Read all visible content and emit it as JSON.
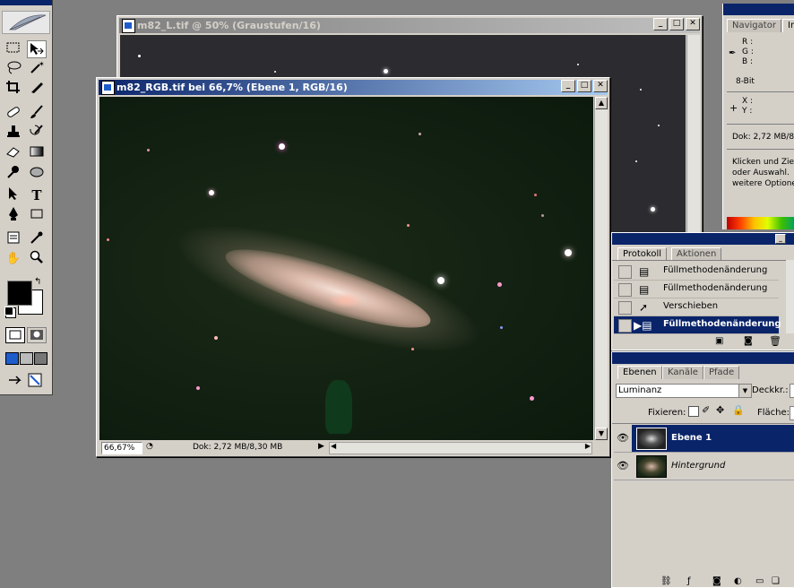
{
  "window_back": {
    "title": "m82_L.tif @ 50% (Graustufen/16)"
  },
  "window_front": {
    "title": "m82_RGB.tif bei 66,7% (Ebene 1, RGB/16)",
    "zoom": "66,67%",
    "doc_info": "Dok: 2,72 MB/8,30 MB"
  },
  "navigator": {
    "tab_navigator": "Navigator",
    "tab_info": "In",
    "r": "R :",
    "g": "G :",
    "b": "B :",
    "bit": "8-Bit",
    "x": "X :",
    "y": "Y :",
    "dok": "Dok: 2,72 MB/8",
    "hint": [
      "Klicken und Zie",
      "oder Auswahl.",
      "weitere Optione"
    ]
  },
  "protokoll": {
    "tab_protokoll": "Protokoll",
    "tab_aktionen": "Aktionen",
    "items": [
      "Füllmethodenänderung",
      "Füllmethodenänderung",
      "Verschieben",
      "Füllmethodenänderung"
    ]
  },
  "ebenen": {
    "tab_ebenen": "Ebenen",
    "tab_kanaele": "Kanäle",
    "tab_pfade": "Pfade",
    "blend_mode": "Luminanz",
    "opacity_label": "Deckkr.:",
    "lock_label": "Fixieren:",
    "fill_label": "Fläche:",
    "layers": [
      "Ebene 1",
      "Hintergrund"
    ]
  },
  "toolbox": {
    "tools": [
      "marquee-icon",
      "move-icon",
      "lasso-icon",
      "magic-wand-icon",
      "crop-icon",
      "slice-icon",
      "healing-icon",
      "brush-icon",
      "stamp-icon",
      "history-brush-icon",
      "eraser-icon",
      "gradient-icon",
      "dodge-icon",
      "blur-icon",
      "path-select-icon",
      "type-icon",
      "pen-icon",
      "shape-icon",
      "notes-icon",
      "eyedropper-icon",
      "hand-icon",
      "zoom-icon"
    ],
    "foreground": "#000000",
    "background": "#ffffff"
  }
}
